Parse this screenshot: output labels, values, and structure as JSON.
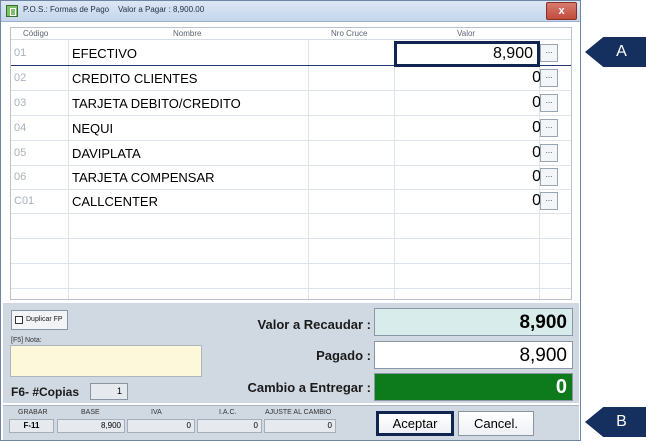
{
  "window": {
    "title": "P.O.S.: Formas de Pago",
    "amount_to_pay": "Valor a Pagar : 8,900.00",
    "close_label": "x"
  },
  "grid": {
    "headers": {
      "code": "Código",
      "name": "Nombre",
      "cross": "Nro Cruce",
      "value": "Valor"
    },
    "rows": [
      {
        "code": "01",
        "name": "EFECTIVO",
        "value": "8,900"
      },
      {
        "code": "02",
        "name": "CREDITO CLIENTES",
        "value": "0"
      },
      {
        "code": "03",
        "name": "TARJETA DEBITO/CREDITO",
        "value": "0"
      },
      {
        "code": "04",
        "name": "NEQUI",
        "value": "0"
      },
      {
        "code": "05",
        "name": "DAVIPLATA",
        "value": "0"
      },
      {
        "code": "06",
        "name": "TARJETA COMPENSAR",
        "value": "0"
      },
      {
        "code": "C01",
        "name": "CALLCENTER",
        "value": "0"
      }
    ],
    "dots_label": "..."
  },
  "panel": {
    "duplicate_label": "Duplicar FP",
    "note_label": "[F5] Nota:",
    "note_value": "",
    "copies_label": "F6- #Copias",
    "copies_value": "1"
  },
  "summary": {
    "collect_label": "Valor a Recaudar :",
    "collect_value": "8,900",
    "paid_label": "Pagado :",
    "paid_value": "8,900",
    "change_label": "Cambio a Entregar :",
    "change_value": "0"
  },
  "status": {
    "save_label": "GRABAR",
    "save_key": "F-11",
    "base_label": "BASE",
    "base_value": "8,900",
    "iva_label": "IVA",
    "iva_value": "0",
    "iac_label": "I.A.C.",
    "iac_value": "0",
    "adjust_label": "AJUSTE AL CAMBIO",
    "adjust_value": "0"
  },
  "buttons": {
    "accept": "Aceptar",
    "cancel": "Cancel."
  },
  "callouts": {
    "a": "A",
    "b": "B"
  },
  "colors": {
    "change_bg": "#0d7a1c",
    "callout_bg": "#152f5e",
    "collect_bg": "#d8ecec"
  }
}
